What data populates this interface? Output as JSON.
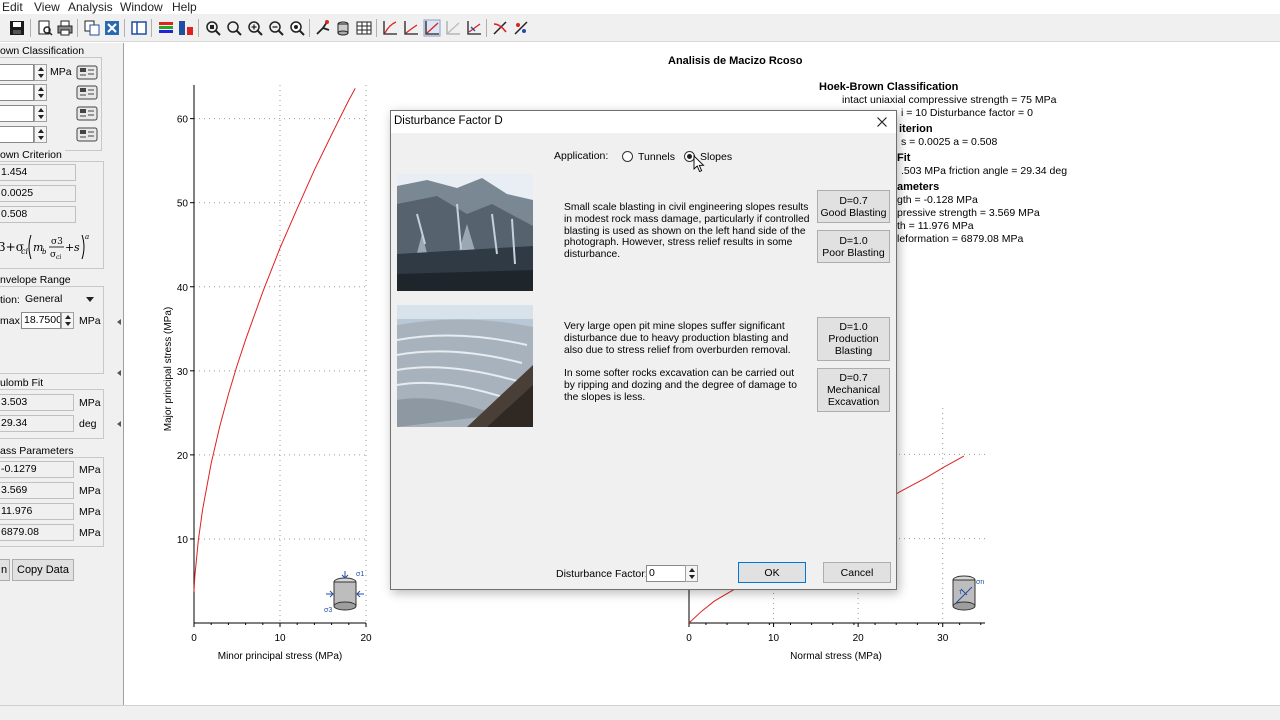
{
  "menu": [
    "Edit",
    "View",
    "Analysis",
    "Window",
    "Help"
  ],
  "left_panel": {
    "hb_classification": {
      "title": "own Classification",
      "unit": "MPa"
    },
    "hb_criterion": {
      "title": "own Criterion",
      "values": [
        "1.454",
        "0.0025",
        "0.508"
      ]
    },
    "envelope_range": {
      "title": "nvelope Range",
      "application_label": "tion:",
      "application_value": "General",
      "max_label": "max",
      "max_value": "18.7500",
      "max_unit": "MPa"
    },
    "mohr_coulomb": {
      "title": "ulomb Fit",
      "rows": [
        {
          "value": "3.503",
          "unit": "MPa"
        },
        {
          "value": "29.34",
          "unit": "deg"
        }
      ]
    },
    "mass_params": {
      "title": "ass Parameters",
      "rows": [
        {
          "value": "-0.1279",
          "unit": "MPa"
        },
        {
          "value": "3.569",
          "unit": "MPa"
        },
        {
          "value": "11.976",
          "unit": "MPa"
        },
        {
          "value": "6879.08",
          "unit": "MPa"
        }
      ]
    },
    "copy_label": "n",
    "copy_data_button": "Copy Data"
  },
  "plot": {
    "title": "Analisis de Macizo Rcoso",
    "results_header": "Hoek-Brown Classification",
    "results_lines": [
      "intact uniaxial compressive strength = 75 MPa",
      "i = 10   Disturbance factor = 0",
      "iterion",
      "s = 0.0025    a = 0.508",
      "Fit",
      ".503 MPa    friction angle = 29.34 deg",
      "ameters",
      "gth = -0.128 MPa",
      "pressive strength = 3.569 MPa",
      "th = 11.976 MPa",
      "leformation = 6879.08 MPa"
    ],
    "sigma1_label": "σ1",
    "sigma3_label": "σ3",
    "sigma_n_label": "σn",
    "tau_label": "τ"
  },
  "chart_data": [
    {
      "type": "line",
      "xlabel": "Minor principal stress (MPa)",
      "ylabel": "Major principal stress (MPa)",
      "xlim": [
        0,
        20
      ],
      "ylim": [
        0,
        64
      ],
      "xticks": [
        0,
        10,
        20
      ],
      "yticks": [
        10,
        20,
        30,
        40,
        50,
        60
      ],
      "grid": true,
      "color": "#e02020",
      "series": [
        {
          "x": [
            0,
            0.1,
            0.5,
            1,
            2,
            3,
            4,
            5,
            6,
            8,
            10,
            12,
            14,
            16,
            18,
            18.75
          ],
          "y": [
            3.75,
            5.6,
            9.8,
            13.5,
            19.0,
            23.4,
            27.2,
            30.6,
            33.7,
            39.4,
            44.6,
            49.3,
            53.9,
            58.1,
            62.2,
            63.6
          ]
        }
      ]
    },
    {
      "type": "line",
      "xlabel": "Normal stress (MPa)",
      "ylabel": "",
      "xlim": [
        0,
        35
      ],
      "xticks": [
        0,
        10,
        20,
        30
      ],
      "grid": true,
      "color": "#e02020",
      "series": [
        {
          "x": [
            0,
            1.5,
            3,
            25,
            28,
            30,
            32.5
          ],
          "y": [
            0,
            1.4,
            2.6,
            15.6,
            17.2,
            18.4,
            19.8
          ]
        }
      ]
    }
  ],
  "dialog": {
    "title": "Disturbance Factor D",
    "application_label": "Application:",
    "options": [
      "Tunnels",
      "Slopes"
    ],
    "selected": "Slopes",
    "text1": [
      "Small scale blasting in civil engineering slopes results",
      "in modest rock mass damage, particularly if controlled",
      "blasting is used as shown on the left hand side of the",
      "photograph. However, stress relief results in some",
      "disturbance."
    ],
    "text2": [
      "Very large open pit mine slopes suffer significant",
      "disturbance due to heavy production blasting and",
      "also due to stress relief from overburden removal."
    ],
    "text3": [
      "In some softer rocks excavation can be carried out",
      "by ripping and dozing and the degree of damage to",
      "the slopes is less."
    ],
    "buttons": [
      [
        "D=0.7",
        "Good Blasting"
      ],
      [
        "D=1.0",
        "Poor Blasting"
      ],
      [
        "D=1.0",
        "Production",
        "Blasting"
      ],
      [
        "D=0.7",
        "Mechanical",
        "Excavation"
      ]
    ],
    "factor_label": "Disturbance Factor:",
    "factor_value": "0",
    "ok_label": "OK",
    "cancel_label": "Cancel"
  }
}
